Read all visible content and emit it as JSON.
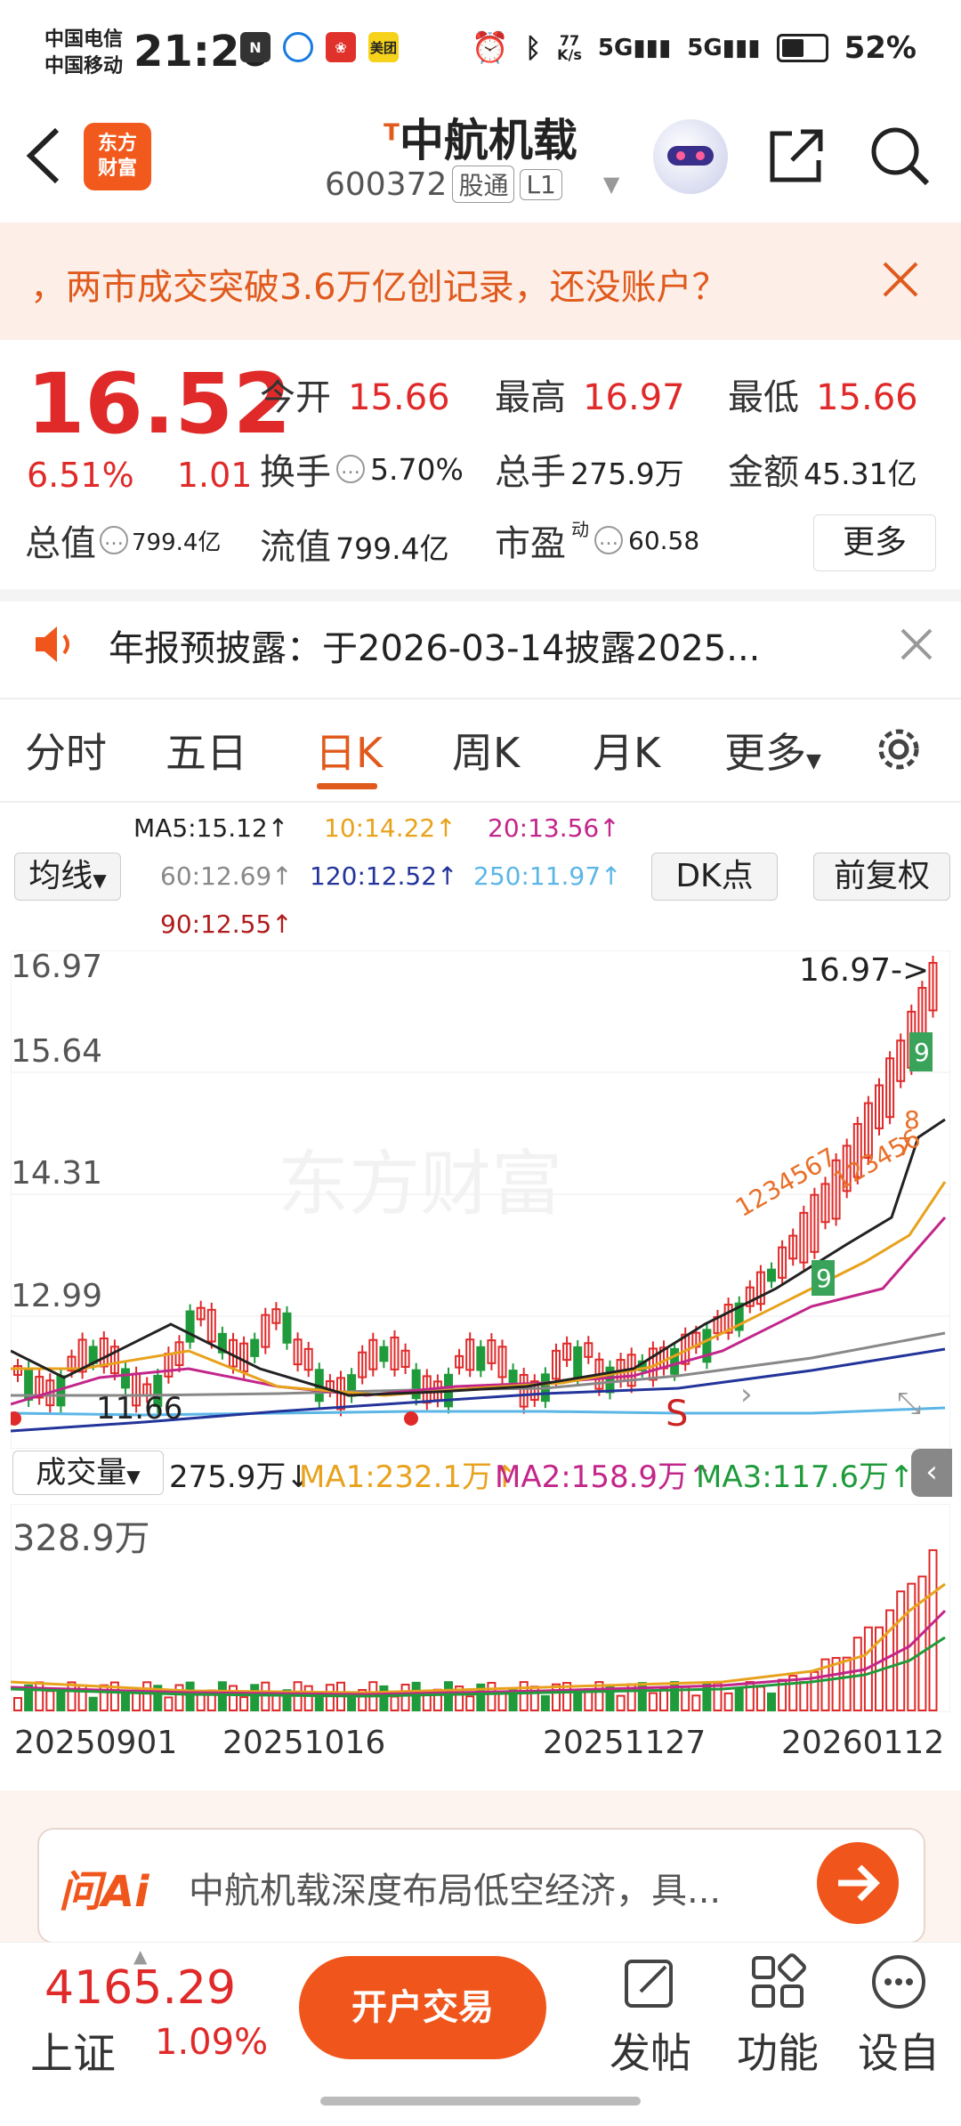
{
  "status_bar": {
    "carrier1": "中国电信",
    "carrier2": "中国移动",
    "time": "21:26",
    "net_speed_top": "77",
    "net_speed_bottom": "K/s",
    "battery": "52%",
    "app_badge_meituan": "美团"
  },
  "header": {
    "logo_line1": "东方",
    "logo_line2": "财富",
    "stock_prefix": "T",
    "stock_name": "中航机载",
    "stock_code": "600372",
    "tag1": "股通",
    "tag2": "L1"
  },
  "banner": {
    "text": "，两市成交突破3.6万亿创记录，还没账户？"
  },
  "quote": {
    "price": "16.52",
    "change_pct": "6.51%",
    "change_amt": "1.01",
    "open_label": "今开",
    "open": "15.66",
    "high_label": "最高",
    "high": "16.97",
    "low_label": "最低",
    "low": "15.66",
    "turnover_label": "换手",
    "turnover": "5.70%",
    "volume_label": "总手",
    "volume": "275.9万",
    "amount_label": "金额",
    "amount": "45.31亿",
    "mktcap_label": "总值",
    "mktcap": "799.4亿",
    "float_label": "流值",
    "float": "799.4亿",
    "pe_label": "市盈",
    "pe_sup": "动",
    "pe": "60.58",
    "more_label": "更多"
  },
  "notice": {
    "text": "年报预披露：于2026-03-14披露2025..."
  },
  "tabs": {
    "t1": "分时",
    "t2": "五日",
    "t3": "日K",
    "t4": "周K",
    "t5": "月K",
    "t6": "更多"
  },
  "ma_legend": {
    "ma5": "MA5:15.12↑",
    "ma10": "10:14.22↑",
    "ma20": "20:13.56↑",
    "ma60": "60:12.69↑",
    "ma120": "120:12.52↑",
    "ma250": "250:11.97↑",
    "ma90": "90:12.55↑",
    "junxian": "均线",
    "dk": "DK点",
    "fq": "前复权"
  },
  "chart": {
    "y_labels": [
      "16.97",
      "15.64",
      "14.31",
      "12.99"
    ],
    "max_label": "16.97->",
    "min_label": "11.66",
    "watermark": "东方财富",
    "s_marker": "S",
    "td9_a": "9",
    "td9_b": "9",
    "td_seq_1": "1234567",
    "td_seq_2": "123456",
    "td_seq_3": "7",
    "td_seq_4": "8"
  },
  "volume": {
    "label": "成交量",
    "vol": "275.9万↓",
    "ma1": "MA1:232.1万↑",
    "ma2": "MA2:158.9万↑",
    "ma3": "MA3:117.6万↑",
    "max": "328.9万"
  },
  "x_dates": [
    "20250901",
    "20251016",
    "20251127",
    "20260112"
  ],
  "ai": {
    "logo": "问Ai",
    "text": "中航机载深度布局低空经济，具..."
  },
  "bottom": {
    "index_value": "4165.29",
    "index_name": "上证",
    "index_pct": "1.09%",
    "open_account": "开户交易",
    "post": "发帖",
    "functions": "功能",
    "custom": "设自"
  },
  "colors": {
    "up": "#e02a2a",
    "down": "#1f9b3b",
    "accent": "#f0561c",
    "ma5": "#222222",
    "ma10": "#e8a21c",
    "ma20": "#c2268a",
    "ma60": "#888888",
    "ma120": "#23349a",
    "ma250": "#5bb6e6",
    "ma90": "#b01c1c"
  },
  "chart_data": {
    "type": "candlestick",
    "x_range": [
      "20250901",
      "20260112"
    ],
    "y_range": [
      11.66,
      16.97
    ],
    "last": {
      "open": 15.66,
      "high": 16.97,
      "low": 15.66,
      "close": 16.52
    }
  }
}
